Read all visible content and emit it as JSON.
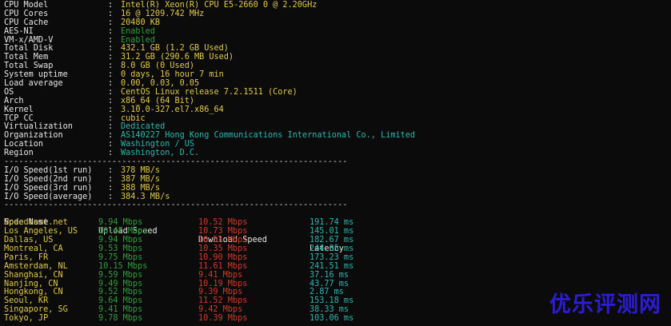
{
  "colors": {
    "background": "#0b0b0b",
    "label": "#e6e6e6",
    "value_yellow": "#e0c94a",
    "value_cyan": "#2fb6b0",
    "value_green": "#2f9e3c",
    "download_red": "#d23a2a",
    "watermark": "#2d1cd6"
  },
  "sysinfo": [
    {
      "label": "CPU Model",
      "value": "Intel(R) Xeon(R) CPU E5-2660 0 @ 2.20GHz",
      "color": "yellow"
    },
    {
      "label": "CPU Cores",
      "value": "16 @ 1209.742 MHz",
      "color": "yellow"
    },
    {
      "label": "CPU Cache",
      "value": "20480 KB",
      "color": "yellow"
    },
    {
      "label": "AES-NI",
      "value": "Enabled",
      "color": "green"
    },
    {
      "label": "VM-x/AMD-V",
      "value": "Enabled",
      "color": "green"
    },
    {
      "label": "Total Disk",
      "value": "432.1 GB (1.2 GB Used)",
      "color": "yellow"
    },
    {
      "label": "Total Mem",
      "value": "31.2 GB (290.6 MB Used)",
      "color": "yellow"
    },
    {
      "label": "Total Swap",
      "value": "8.0 GB (0 Used)",
      "color": "yellow"
    },
    {
      "label": "System uptime",
      "value": "0 days, 16 hour 7 min",
      "color": "yellow"
    },
    {
      "label": "Load average",
      "value": "0.00, 0.03, 0.05",
      "color": "yellow"
    },
    {
      "label": "OS",
      "value": "CentOS Linux release 7.2.1511 (Core)",
      "color": "yellow"
    },
    {
      "label": "Arch",
      "value": "x86_64 (64 Bit)",
      "color": "yellow"
    },
    {
      "label": "Kernel",
      "value": "3.10.0-327.el7.x86_64",
      "color": "yellow"
    },
    {
      "label": "TCP CC",
      "value": "cubic",
      "color": "yellow"
    },
    {
      "label": "Virtualization",
      "value": "Dedicated",
      "color": "cyan"
    },
    {
      "label": "Organization",
      "value": "AS140227 Hong Kong Communications International Co., Limited",
      "color": "cyan"
    },
    {
      "label": "Location",
      "value": "Washington / US",
      "color": "cyan"
    },
    {
      "label": "Region",
      "value": "Washington, D.C.",
      "color": "cyan"
    }
  ],
  "separator": ": ",
  "divider": "----------------------------------------------------------------------",
  "io": [
    {
      "label": "I/O Speed(1st run)",
      "value": "378 MB/s"
    },
    {
      "label": "I/O Speed(2nd run)",
      "value": "387 MB/s"
    },
    {
      "label": "I/O Speed(3rd run)",
      "value": "388 MB/s"
    },
    {
      "label": "I/O Speed(average)",
      "value": "384.3 MB/s"
    }
  ],
  "speedtest": {
    "headers": {
      "node": "Node Name",
      "upload": "Upload Speed",
      "download": "Download Speed",
      "latency": "Latency"
    },
    "rows": [
      {
        "node": "Speedtest.net",
        "upload": "9.94 Mbps",
        "download": "10.52 Mbps",
        "latency": "191.74 ms"
      },
      {
        "node": "Los Angeles, US",
        "upload": "10.47 Mbps",
        "download": "10.73 Mbps",
        "latency": "145.01 ms"
      },
      {
        "node": "Dallas, US",
        "upload": "9.94 Mbps",
        "download": "10.53 Mbps",
        "latency": "182.67 ms"
      },
      {
        "node": "Montreal, CA",
        "upload": "9.53 Mbps",
        "download": "10.35 Mbps",
        "latency": "244.85 ms"
      },
      {
        "node": "Paris, FR",
        "upload": "9.75 Mbps",
        "download": "10.90 Mbps",
        "latency": "173.23 ms"
      },
      {
        "node": "Amsterdam, NL",
        "upload": "10.15 Mbps",
        "download": "11.61 Mbps",
        "latency": "241.51 ms"
      },
      {
        "node": "Shanghai, CN",
        "upload": "9.59 Mbps",
        "download": "9.41 Mbps",
        "latency": "37.16 ms"
      },
      {
        "node": "Nanjing, CN",
        "upload": "9.49 Mbps",
        "download": "10.19 Mbps",
        "latency": "43.77 ms"
      },
      {
        "node": "Hongkong, CN",
        "upload": "9.52 Mbps",
        "download": "9.39 Mbps",
        "latency": "2.87 ms"
      },
      {
        "node": "Seoul, KR",
        "upload": "9.64 Mbps",
        "download": "11.52 Mbps",
        "latency": "153.18 ms"
      },
      {
        "node": "Singapore, SG",
        "upload": "9.41 Mbps",
        "download": "9.42 Mbps",
        "latency": "38.33 ms"
      },
      {
        "node": "Tokyo, JP",
        "upload": "9.78 Mbps",
        "download": "10.39 Mbps",
        "latency": "103.06 ms"
      }
    ]
  },
  "watermark": "优乐评测网"
}
